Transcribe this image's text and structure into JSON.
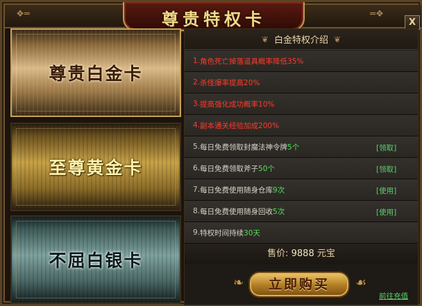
{
  "window": {
    "title": "尊贵特权卡",
    "close_label": "X"
  },
  "cards": [
    {
      "label": "尊贵白金卡",
      "state": "selected"
    },
    {
      "label": "至尊黄金卡",
      "state": "normal"
    },
    {
      "label": "不屈白银卡",
      "state": "normal"
    }
  ],
  "panel": {
    "header": "白金特权介绍",
    "rows": [
      {
        "num": "1.",
        "text": "角色死亡掉落道具概率降低35%",
        "highlight": true
      },
      {
        "num": "2.",
        "text": "杀怪爆率提高20%",
        "highlight": true
      },
      {
        "num": "3.",
        "text": "提高强化成功概率10%",
        "highlight": true
      },
      {
        "num": "4.",
        "text": "副本通关经验加成200%",
        "highlight": true
      },
      {
        "num": "5.",
        "pre": "每日免费领取封魔法神令牌",
        "em": "5个",
        "action": "[领取]"
      },
      {
        "num": "6.",
        "pre": "每日免费领取斧子",
        "em": "50个",
        "action": "[领取]"
      },
      {
        "num": "7.",
        "pre": "每日免费使用随身仓库",
        "em": "9次",
        "action": "[使用]"
      },
      {
        "num": "8.",
        "pre": "每日免费使用随身回收",
        "em": "5次",
        "action": "[使用]"
      },
      {
        "num": "9.",
        "pre": "特权时间持续",
        "em": "30天"
      }
    ],
    "price": {
      "label": "售价:",
      "value": "9888",
      "currency": "元宝"
    },
    "buy_label": "立即购买",
    "recharge_label": "前往充值"
  }
}
